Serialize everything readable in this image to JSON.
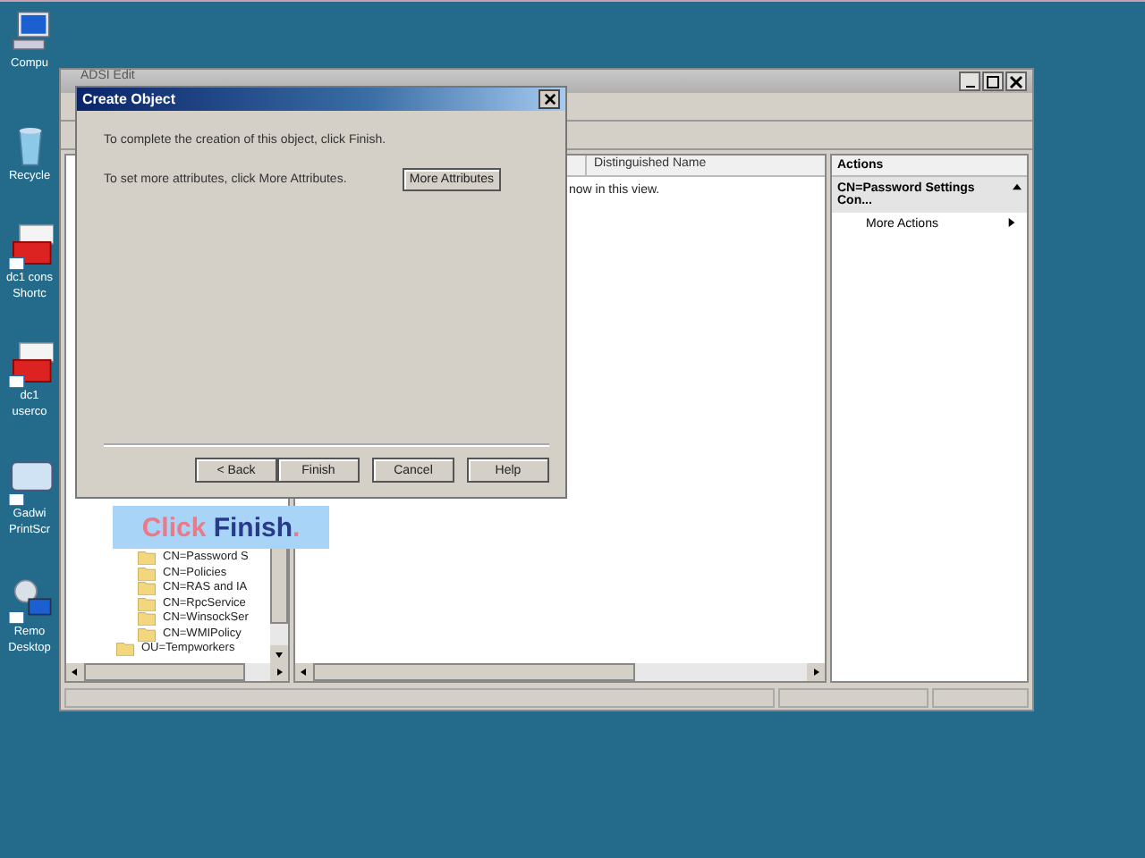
{
  "desktop_icons": [
    {
      "lines": [
        "Compu"
      ],
      "kind": "computer"
    },
    {
      "lines": [
        "Recycle"
      ],
      "kind": "recycle"
    },
    {
      "lines": [
        "dc1 cons",
        "Shortc"
      ],
      "kind": "toolbox"
    },
    {
      "lines": [
        "dc1",
        "userco"
      ],
      "kind": "toolbox"
    },
    {
      "lines": [
        "Gadwi",
        "PrintScr"
      ],
      "kind": "monitor"
    },
    {
      "lines": [
        "Remo",
        "Desktop"
      ],
      "kind": "remote"
    }
  ],
  "main_window": {
    "title": "ADSI Edit",
    "tree_items": [
      {
        "label": "CN=Password S",
        "kind": "folder"
      },
      {
        "label": "CN=Policies",
        "kind": "folder"
      },
      {
        "label": "CN=RAS and IA",
        "kind": "folder"
      },
      {
        "label": "CN=RpcService",
        "kind": "folder"
      },
      {
        "label": "CN=WinsockSer",
        "kind": "folder"
      },
      {
        "label": "CN=WMIPolicy",
        "kind": "folder"
      },
      {
        "label": "OU=Tempworkers",
        "kind": "ou"
      }
    ],
    "list": {
      "columns": [
        "Distinguished Name"
      ],
      "empty_message": "now in this view."
    },
    "actions": {
      "title": "Actions",
      "section": "CN=Password Settings Con...",
      "items": [
        "More Actions"
      ]
    }
  },
  "dialog": {
    "title": "Create Object",
    "message": "To complete the creation of this object, click Finish.",
    "attributes_hint": "To set more attributes, click More Attributes.",
    "more_button": "More Attributes",
    "buttons": [
      "< Back",
      "Finish",
      "Cancel",
      "Help"
    ]
  },
  "callout": {
    "words": [
      {
        "text": "Click",
        "kind": "plain"
      },
      {
        "text": "Finish",
        "kind": "emphasis"
      },
      {
        "text": ".",
        "kind": "plain"
      }
    ]
  }
}
